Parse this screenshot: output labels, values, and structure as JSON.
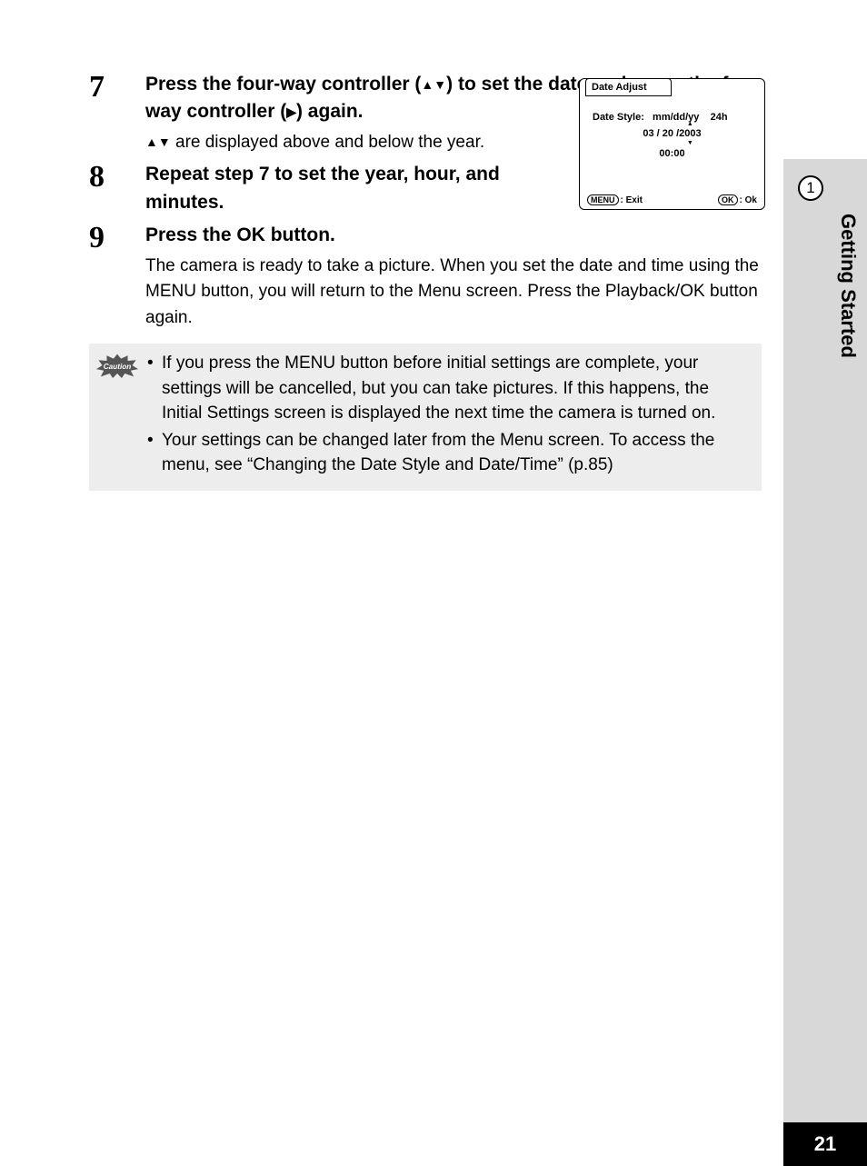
{
  "steps": {
    "s7": {
      "num": "7",
      "title_a": "Press the four-way controller (",
      "title_b": ") to set the date and press the four-way controller (",
      "title_c": ") again.",
      "sub_a": "",
      "sub_b": " are displayed above and below the year."
    },
    "s8": {
      "num": "8",
      "title": "Repeat step 7 to set the year, hour, and minutes."
    },
    "s9": {
      "num": "9",
      "title": "Press the OK button.",
      "para": "The camera is ready to take a picture. When you set the date and time using the MENU button, you will return to the Menu screen. Press the Playback/OK button again."
    }
  },
  "caution": {
    "label": "Caution",
    "items": [
      "If you press the MENU button before initial settings are complete, your settings will be cancelled, but you can take pictures. If this happens, the Initial Settings screen is displayed the next time the camera is turned on.",
      "Your settings can be changed later from the Menu screen. To access the menu, see “Changing the Date Style and Date/Time” (p.85)"
    ]
  },
  "lcd": {
    "title": "Date Adjust",
    "date_style_label": "Date Style:",
    "date_style_value": "mm/dd/yy",
    "hour_mode": "24h",
    "date_month": "03",
    "date_sep": " / ",
    "date_day": "20",
    "date_sep2": " /",
    "date_year": "2003",
    "time": "00:00",
    "menu_btn": "MENU",
    "menu_lbl": ": Exit",
    "ok_btn": "OK",
    "ok_lbl": ": Ok"
  },
  "side": {
    "section_num": "1",
    "section_title": "Getting Started",
    "page_num": "21"
  },
  "glyphs": {
    "up": "▲",
    "down": "▼",
    "right": "▶",
    "updown": "▲▼"
  }
}
